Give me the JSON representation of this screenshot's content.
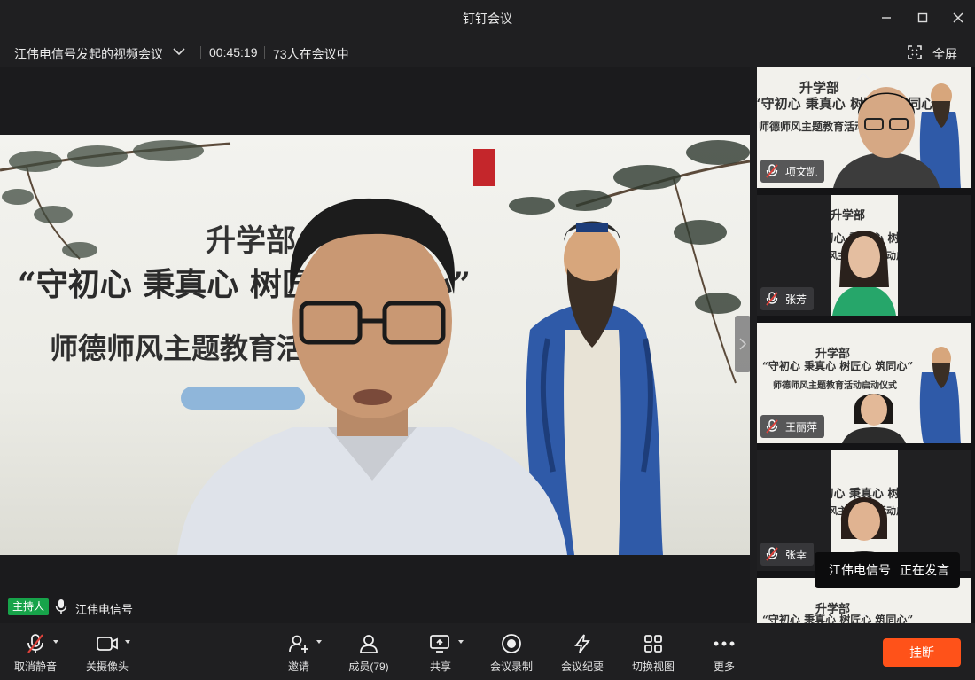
{
  "window": {
    "title": "钉钉会议"
  },
  "info_bar": {
    "meeting_name": "江伟电信号发起的视频会议",
    "duration": "00:45:19",
    "participants_status": "73人在会议中",
    "fullscreen_label": "全屏"
  },
  "main_video": {
    "slide_line1": "升学部",
    "slide_line2": "“守初心 秉真心 树匠心 筑同心”",
    "slide_line3": "师德师风主题教育活动启动仪式",
    "host_badge": "主持人",
    "speaker_name": "江伟电信号"
  },
  "participants": [
    {
      "name": "项文凯",
      "muted": true
    },
    {
      "name": "张芳",
      "muted": true
    },
    {
      "name": "王丽萍",
      "muted": true
    },
    {
      "name": "张幸",
      "muted": true
    },
    {
      "name": "",
      "muted": true
    }
  ],
  "thumb_slide": {
    "line1": "升学部",
    "line2": "“守初心 秉真心 树匠心 筑同心”",
    "line3": "师德师风主题教育活动启动仪式"
  },
  "speaking_toast": {
    "name": "江伟电信号",
    "status": "正在发言"
  },
  "toolbar": {
    "unmute": "取消静音",
    "camera_off": "关摄像头",
    "invite": "邀请",
    "members": "成员(79)",
    "share": "共享",
    "record": "会议录制",
    "minutes": "会议纪要",
    "switch_view": "切换视图",
    "more": "更多",
    "hangup": "挂断"
  },
  "colors": {
    "hangup": "#ff5219",
    "host_badge": "#17a34a",
    "muted_icon": "#e0413a"
  },
  "icons": [
    "minimize-icon",
    "maximize-icon",
    "close-icon",
    "chevron-down-icon",
    "fullscreen-icon",
    "mic-icon",
    "mic-muted-icon",
    "camera-icon",
    "invite-icon",
    "members-icon",
    "share-icon",
    "record-icon",
    "minutes-icon",
    "grid-view-icon",
    "more-icon"
  ]
}
